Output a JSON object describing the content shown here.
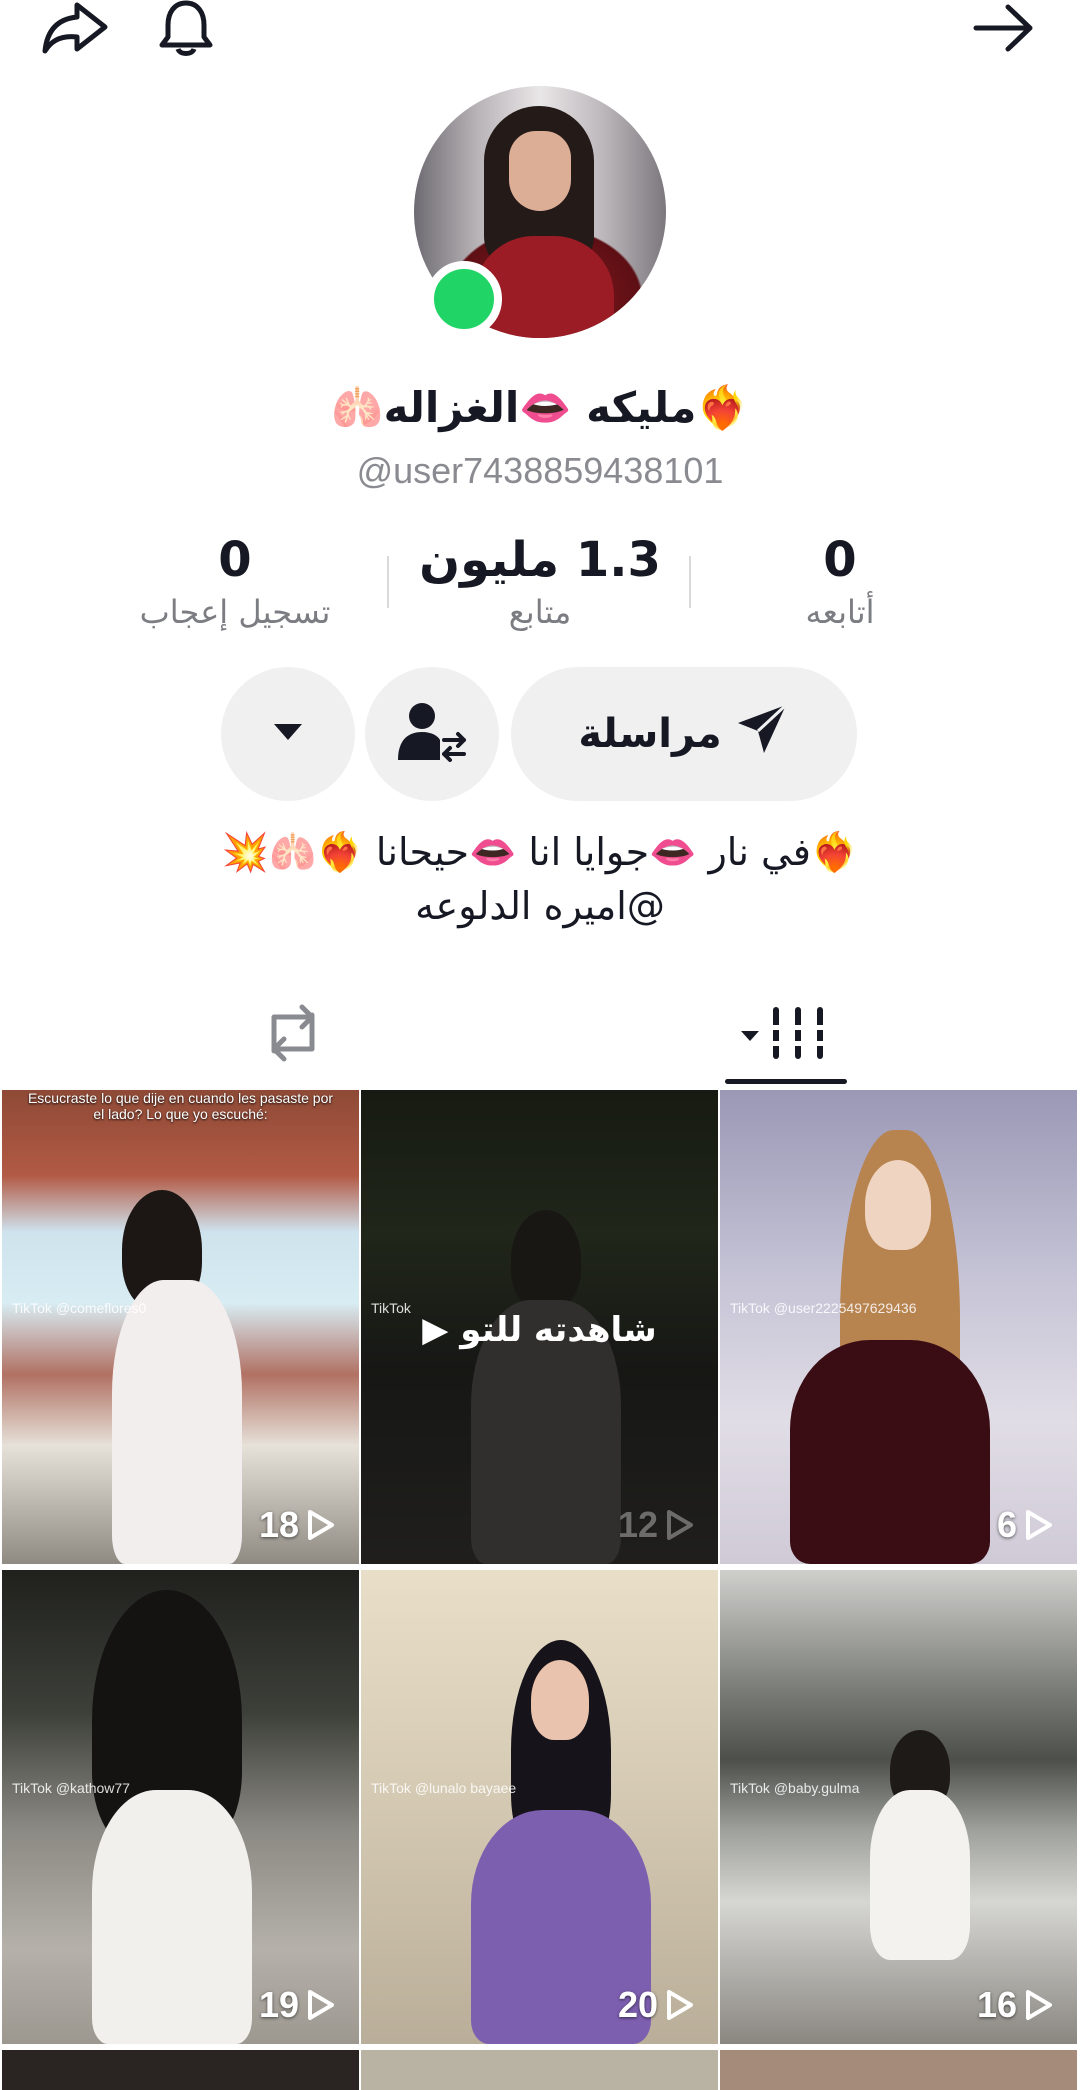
{
  "profile": {
    "name": "❤️‍🔥مليكه 👄الغزاله🫁",
    "handle": "@user7438859438101"
  },
  "stats": [
    {
      "value": "0",
      "label": "تسجيل إعجاب"
    },
    {
      "value": "1.3 مليون",
      "label": "متابع"
    },
    {
      "value": "0",
      "label": "أتابعه"
    }
  ],
  "actions": {
    "message_label": "مراسلة"
  },
  "bio": {
    "line1": "❤️‍🔥في نار 👄جوايا انا 👄حيحانا ❤️‍🔥🫁💥",
    "line2": "@اميره الدلوعه"
  },
  "videos": [
    {
      "count": "18",
      "caption": "Escucraste lo que dije en cuando les pasaste por el lado? Lo que yo escuché:",
      "watermark": "TikTok @comeflores0"
    },
    {
      "count": "12",
      "overlay": "شاهدته للتو",
      "watermark": "TikTok"
    },
    {
      "count": "6",
      "watermark": "TikTok @user2225497629436"
    },
    {
      "count": "19",
      "watermark": "TikTok @kathow77"
    },
    {
      "count": "20",
      "watermark": "TikTok @lunalo bayaee"
    },
    {
      "count": "16",
      "watermark": "TikTok @baby.gulma"
    }
  ],
  "colors": {
    "online": "#20d565",
    "button_bg": "#f0f0f1",
    "text_primary": "#161823",
    "text_secondary": "#8a8b91"
  }
}
